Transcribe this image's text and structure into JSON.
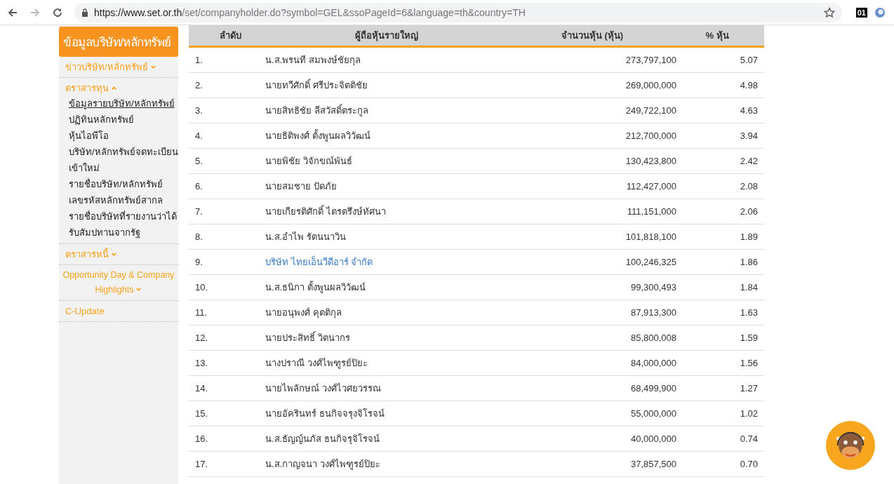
{
  "browser": {
    "url_host": "https://www.set.or.th",
    "url_path": "/set/companyholder.do?symbol=GEL&ssoPageId=6&language=th&country=TH",
    "extension_badge": "01"
  },
  "sidebar": {
    "title": "ข้อมูลบริษัท/หลักทรัพย์",
    "items": [
      {
        "label": "ข่าวบริษัท/หลักทรัพย์",
        "kind": "group",
        "expanded": false
      },
      {
        "label": "ตราสารทุน",
        "kind": "group",
        "expanded": true,
        "children": [
          {
            "label": "ข้อมูลรายบริษัท/หลักทรัพย์",
            "selected": true
          },
          {
            "label": "ปฏิทินหลักทรัพย์",
            "selected": false
          },
          {
            "label": "หุ้นไอพีโอ",
            "selected": false
          },
          {
            "label": "บริษัท/หลักทรัพย์จดทะเบียนเข้าใหม่",
            "selected": false
          },
          {
            "label": "รายชื่อบริษัท/หลักทรัพย์",
            "selected": false
          },
          {
            "label": "เลขรหัสหลักทรัพย์สากล",
            "selected": false
          },
          {
            "label": "รายชื่อบริษัทที่รายงานว่าได้รับสัมปทานจากรัฐ",
            "selected": false
          }
        ]
      },
      {
        "label": "ตราสารหนี้",
        "kind": "group",
        "expanded": false
      },
      {
        "label": "Opportunity Day & Company Highlights",
        "kind": "group",
        "expanded": false
      },
      {
        "label": "C-Update",
        "kind": "link"
      }
    ]
  },
  "table": {
    "columns": [
      "ลำดับ",
      "ผู้ถือหุ้นรายใหญ่",
      "จำนวนหุ้น (หุ้น)",
      "% หุ้น"
    ],
    "rows": [
      {
        "rank": "1.",
        "holder": "น.ส.พรนที สมพงษ์ชัยกุล",
        "kind": "text",
        "shares": "273,797,100",
        "percent": "5.07"
      },
      {
        "rank": "2.",
        "holder": "นายทวีศักดิ์ ศรีประจิตติชัย",
        "kind": "text",
        "shares": "269,000,000",
        "percent": "4.98"
      },
      {
        "rank": "3.",
        "holder": "นายสิทธิชัย ลีสวัสดิ์ตระกูล",
        "kind": "text",
        "shares": "249,722,100",
        "percent": "4.63"
      },
      {
        "rank": "4.",
        "holder": "นายธิติพงศ์ ตั้งพูนผลวิวัฒน์",
        "kind": "text",
        "shares": "212,700,000",
        "percent": "3.94"
      },
      {
        "rank": "5.",
        "holder": "นายพิชัย วิจักขณ์พันธ์",
        "kind": "text",
        "shares": "130,423,800",
        "percent": "2.42"
      },
      {
        "rank": "6.",
        "holder": "นายสมชาย ปัดภัย",
        "kind": "text",
        "shares": "112,427,000",
        "percent": "2.08"
      },
      {
        "rank": "7.",
        "holder": "นายเกียรติศักดิ์ ไตรตรึงษ์ทัศนา",
        "kind": "text",
        "shares": "111,151,000",
        "percent": "2.06"
      },
      {
        "rank": "8.",
        "holder": "น.ส.อำไพ รัตนนาวิน",
        "kind": "text",
        "shares": "101,818,100",
        "percent": "1.89"
      },
      {
        "rank": "9.",
        "holder": "บริษัท ไทยเอ็นวีดีอาร์ จำกัด",
        "kind": "link",
        "shares": "100,246,325",
        "percent": "1.86"
      },
      {
        "rank": "10.",
        "holder": "น.ส.ธนิกา ตั้งพูนผลวิวัฒน์",
        "kind": "text",
        "shares": "99,300,493",
        "percent": "1.84"
      },
      {
        "rank": "11.",
        "holder": "นายอนุพงศ์ คุตติกุล",
        "kind": "text",
        "shares": "87,913,300",
        "percent": "1.63"
      },
      {
        "rank": "12.",
        "holder": "นายประสิทธิ์ วิตนากร",
        "kind": "text",
        "shares": "85,800,008",
        "percent": "1.59"
      },
      {
        "rank": "13.",
        "holder": "นางปราณี วงศ์ไพฑูรย์ปิยะ",
        "kind": "text",
        "shares": "84,000,000",
        "percent": "1.56"
      },
      {
        "rank": "14.",
        "holder": "นายไพลักษณ์ วงศ์ไวศยวรรณ",
        "kind": "text",
        "shares": "68,499,900",
        "percent": "1.27"
      },
      {
        "rank": "15.",
        "holder": "นายอัครินทร์ ธนกิจจรุงจิโรจน์",
        "kind": "text",
        "shares": "55,000,000",
        "percent": "1.02"
      },
      {
        "rank": "16.",
        "holder": "น.ส.ธัญญ์นภัส ธนกิจรุจิโรจน์",
        "kind": "text",
        "shares": "40,000,000",
        "percent": "0.74"
      },
      {
        "rank": "17.",
        "holder": "น.ส.กาญจนา วงศ์ไพฑูรย์ปิยะ",
        "kind": "text",
        "shares": "37,857,500",
        "percent": "0.70"
      }
    ]
  }
}
